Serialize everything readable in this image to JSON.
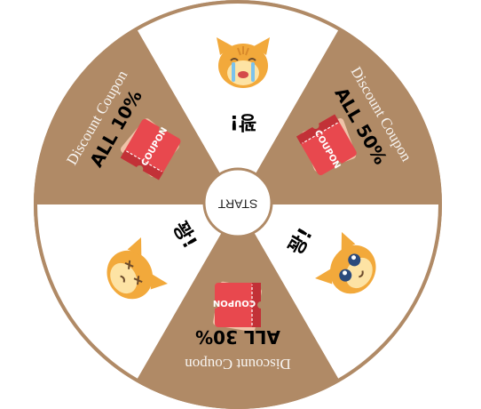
{
  "wheel": {
    "start_label": "START",
    "colors": {
      "prize": "#b08a66",
      "blank": "#ffffff",
      "rim": "#b08a66",
      "coupon_red": "#e8484e",
      "coupon_dark": "#c23137",
      "coupon_back": "#efc3a8",
      "cat_orange": "#f2a93b",
      "cat_light": "#fde3a4"
    },
    "segments": [
      {
        "kind": "blank",
        "text": "꽝!",
        "icon": "crying-cat-icon"
      },
      {
        "kind": "prize",
        "title": "Discount Coupon",
        "value": "ALL 50%",
        "coupon": "COUPON",
        "icon": "coupon-ticket-icon"
      },
      {
        "kind": "blank",
        "text": "꽝!",
        "icon": "teary-eyed-cat-icon"
      },
      {
        "kind": "prize",
        "title": "Discount Coupon",
        "value": "ALL 30%",
        "coupon": "COUPON",
        "icon": "coupon-ticket-icon"
      },
      {
        "kind": "blank",
        "text": "꽝!",
        "icon": "dizzy-cat-icon"
      },
      {
        "kind": "prize",
        "title": "Discount Coupon",
        "value": "ALL 10%",
        "coupon": "COUPON",
        "icon": "coupon-ticket-icon"
      }
    ]
  }
}
